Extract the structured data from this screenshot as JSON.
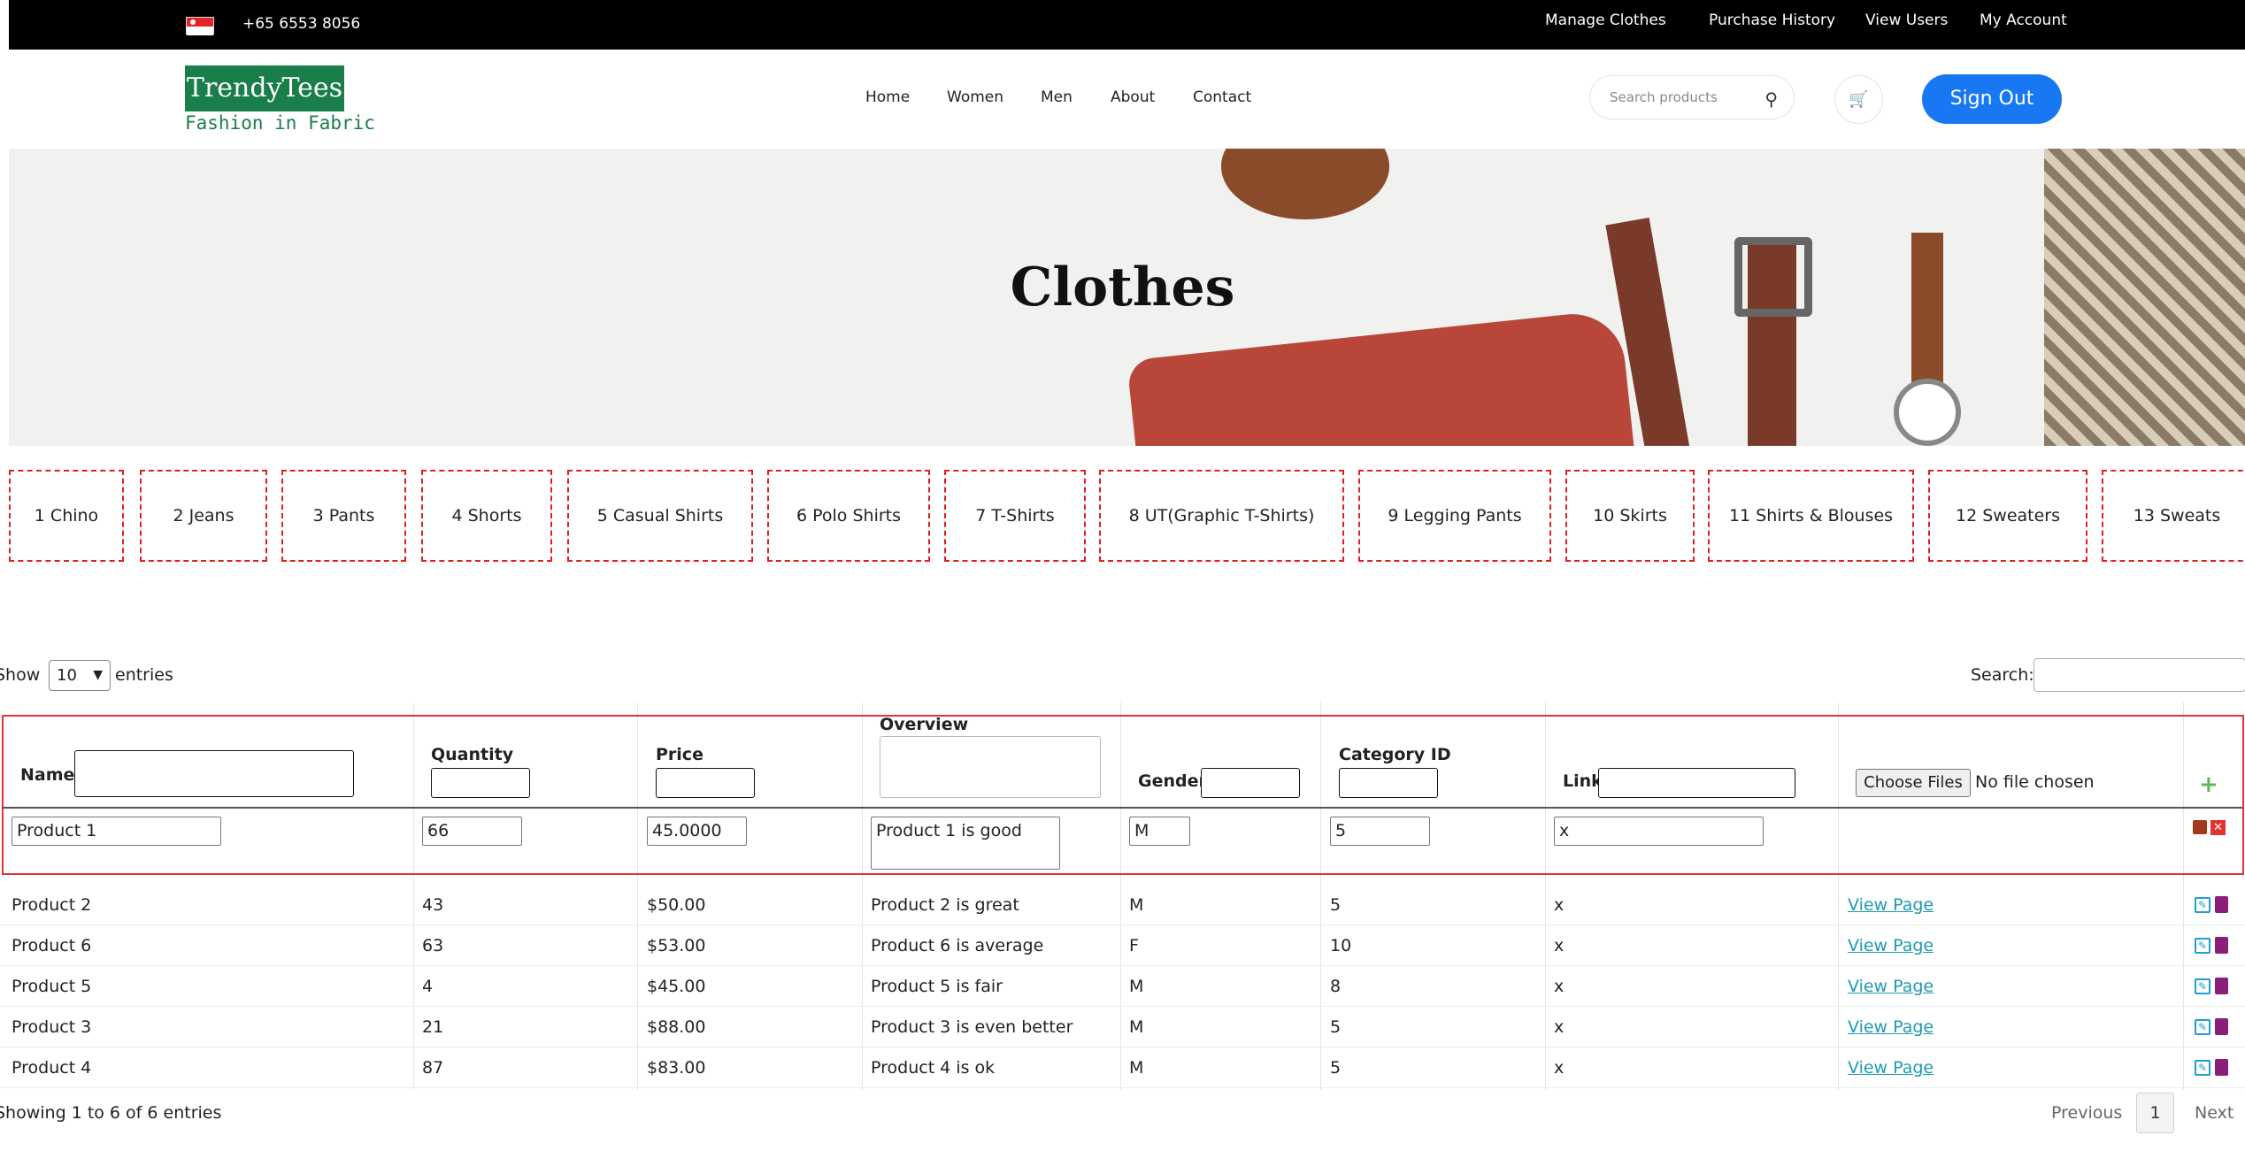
{
  "topbar": {
    "phone": "+65 6553 8056",
    "links": [
      "Manage Clothes",
      "Purchase History",
      "View Users",
      "My Account"
    ]
  },
  "header": {
    "logo": "TrendyTees",
    "tagline": "Fashion in Fabric",
    "nav": [
      "Home",
      "Women",
      "Men",
      "About",
      "Contact"
    ],
    "search_placeholder": "Search products",
    "signout": "Sign Out"
  },
  "banner": {
    "title": "Clothes"
  },
  "categories": [
    "1 Chino",
    "2 Jeans",
    "3 Pants",
    "4 Shorts",
    "5 Casual Shirts",
    "6 Polo Shirts",
    "7 T-Shirts",
    "8 UT(Graphic T-Shirts)",
    "9 Legging Pants",
    "10 Skirts",
    "11 Shirts & Blouses",
    "12 Sweaters",
    "13 Sweats"
  ],
  "datatable": {
    "show_label": "Show",
    "length_value": "10",
    "entries_label": "entries",
    "search_label": "Search:",
    "info": "Showing 1 to 6 of 6 entries",
    "prev": "Previous",
    "page": "1",
    "next": "Next"
  },
  "columns": [
    "Name",
    "Quantity",
    "Price",
    "Overview",
    "Gender",
    "Category ID",
    "Link"
  ],
  "upload": {
    "button": "Choose Files",
    "status": "No file chosen"
  },
  "editing_row": {
    "name": "Product 1",
    "quantity": "66",
    "price": "45.0000",
    "overview": "Product 1 is good",
    "gender": "M",
    "category_id": "5",
    "link": "x"
  },
  "rows": [
    {
      "name": "Product 2",
      "quantity": "43",
      "price": "$50.00",
      "overview": "Product 2 is great",
      "gender": "M",
      "category_id": "5",
      "link": "x",
      "action": "View Page"
    },
    {
      "name": "Product 6",
      "quantity": "63",
      "price": "$53.00",
      "overview": "Product 6 is average",
      "gender": "F",
      "category_id": "10",
      "link": "x",
      "action": "View Page"
    },
    {
      "name": "Product 5",
      "quantity": "4",
      "price": "$45.00",
      "overview": "Product 5 is fair",
      "gender": "M",
      "category_id": "8",
      "link": "x",
      "action": "View Page"
    },
    {
      "name": "Product 3",
      "quantity": "21",
      "price": "$88.00",
      "overview": "Product 3 is even better",
      "gender": "M",
      "category_id": "5",
      "link": "x",
      "action": "View Page"
    },
    {
      "name": "Product 4",
      "quantity": "87",
      "price": "$83.00",
      "overview": "Product 4 is ok",
      "gender": "M",
      "category_id": "5",
      "link": "x",
      "action": "View Page"
    }
  ]
}
